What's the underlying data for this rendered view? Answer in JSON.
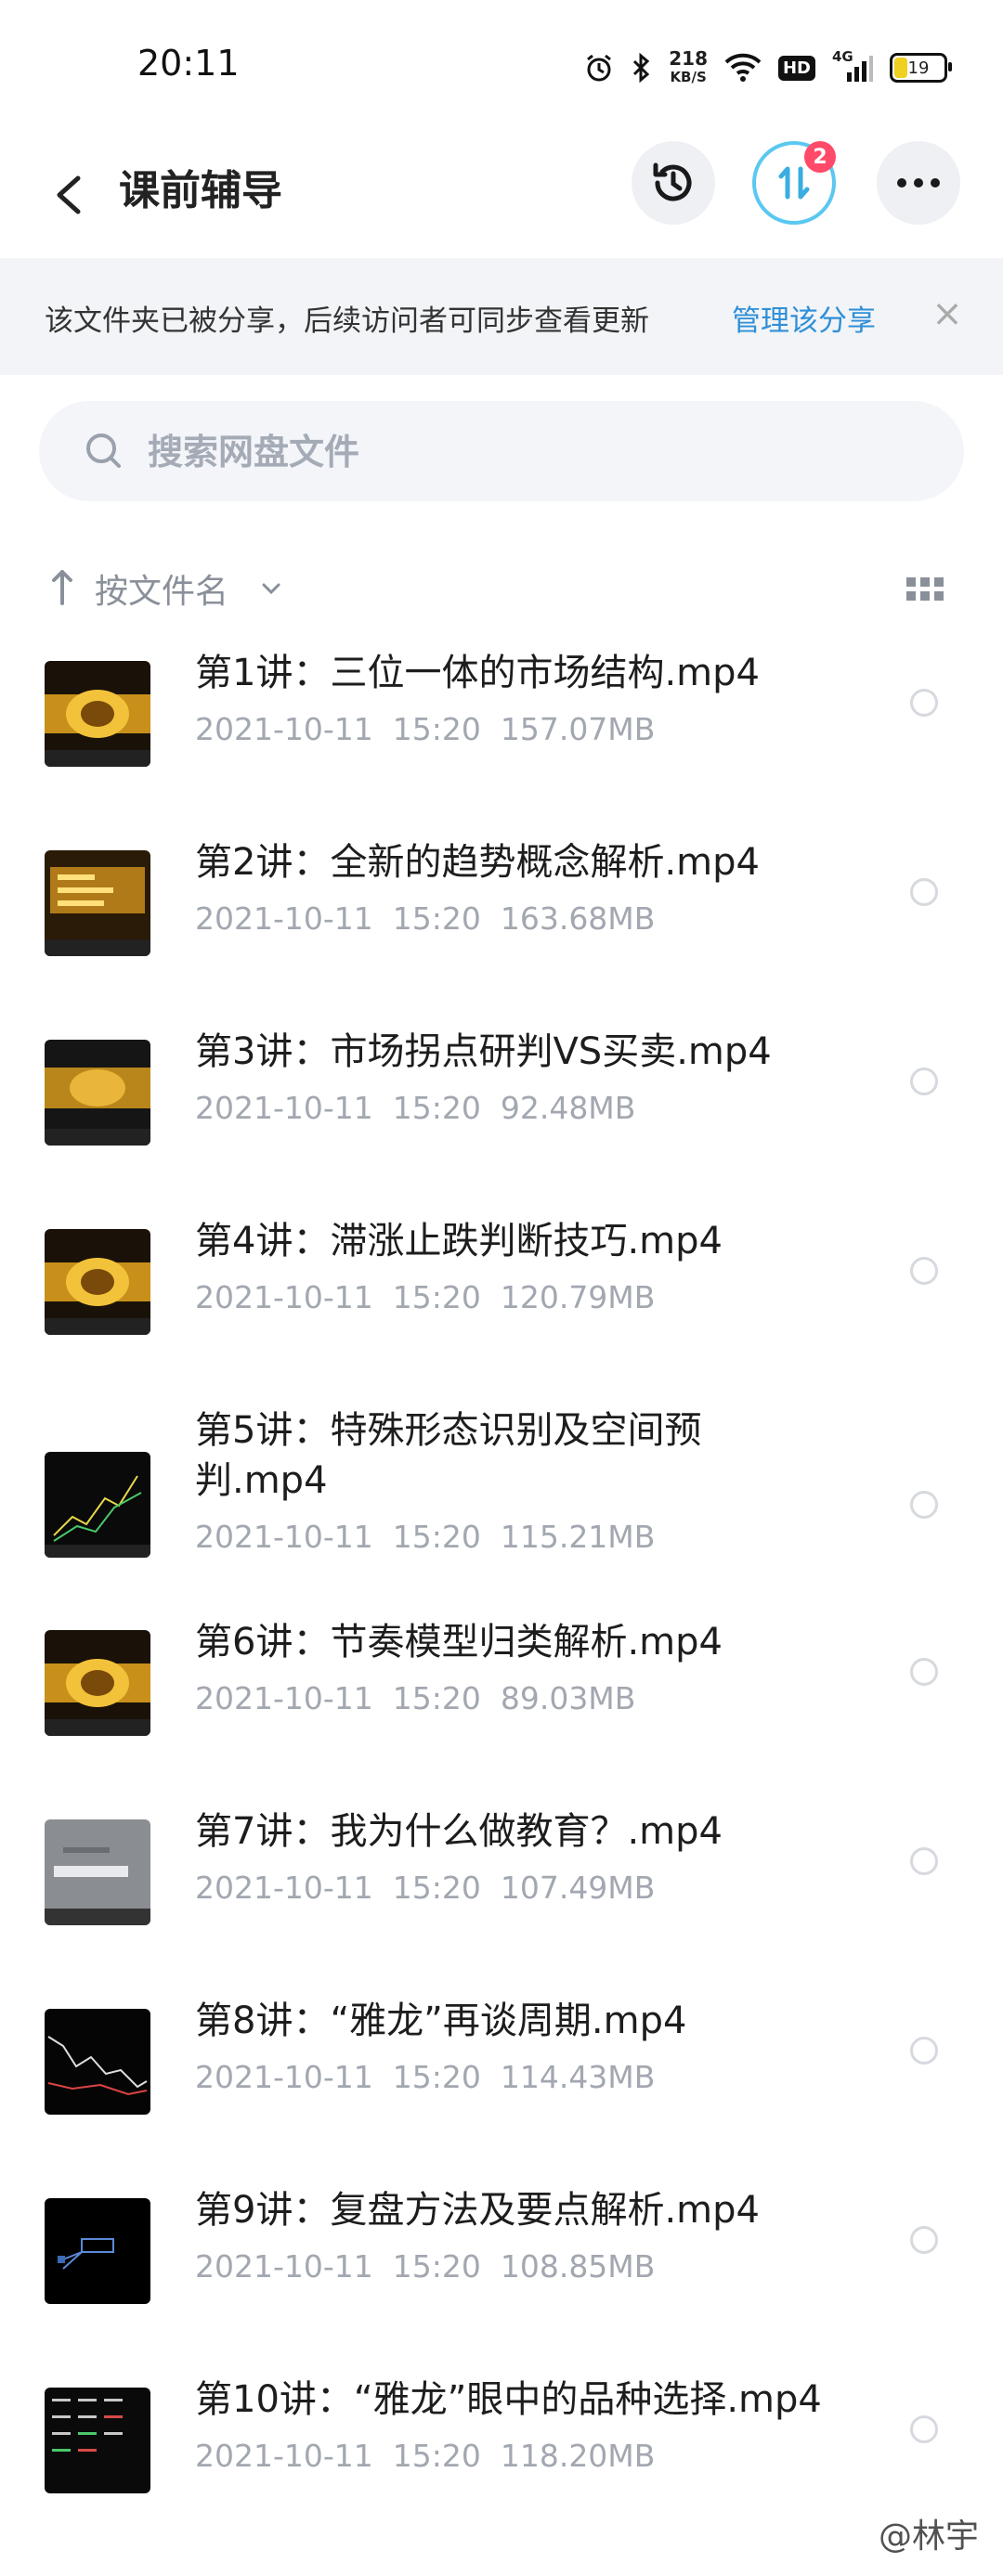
{
  "status_bar": {
    "time": "20:11",
    "network_speed": "218",
    "network_unit": "KB/S",
    "hd_label": "HD",
    "signal_label": "4G",
    "battery": "19"
  },
  "nav": {
    "title": "课前辅导",
    "transfer_badge": "2"
  },
  "share_notice": {
    "text": "该文件夹已被分享，后续访问者可同步查看更新",
    "link": "管理该分享",
    "close": "×"
  },
  "search": {
    "placeholder": "搜索网盘文件"
  },
  "sort": {
    "label": "按文件名"
  },
  "files": [
    {
      "name": "第1讲：三位一体的市场结构.mp4",
      "meta": "2021-10-11  15:20  157.07MB",
      "thumb": "gold"
    },
    {
      "name": "第2讲：全新的趋势概念解析.mp4",
      "meta": "2021-10-11  15:20  163.68MB",
      "thumb": "gold-text"
    },
    {
      "name": "第3讲：市场拐点研判VS买卖.mp4",
      "meta": "2021-10-11  15:20  92.48MB",
      "thumb": "gold-dark"
    },
    {
      "name": "第4讲：滞涨止跌判断技巧.mp4",
      "meta": "2021-10-11  15:20  120.79MB",
      "thumb": "gold"
    },
    {
      "name": "第5讲：特殊形态识别及空间预判.mp4",
      "meta": "2021-10-11  15:20  115.21MB",
      "thumb": "chart"
    },
    {
      "name": "第6讲：节奏模型归类解析.mp4",
      "meta": "2021-10-11  15:20  89.03MB",
      "thumb": "gold"
    },
    {
      "name": "第7讲：我为什么做教育？.mp4",
      "meta": "2021-10-11  15:20  107.49MB",
      "thumb": "gray"
    },
    {
      "name": "第8讲：“雅龙”再谈周期.mp4",
      "meta": "2021-10-11  15:20  114.43MB",
      "thumb": "chart-dark"
    },
    {
      "name": "第9讲：复盘方法及要点解析.mp4",
      "meta": "2021-10-11  15:20  108.85MB",
      "thumb": "black"
    },
    {
      "name": "第10讲：“雅龙”眼中的品种选择.mp4",
      "meta": "2021-10-11  15:20  118.20MB",
      "thumb": "table"
    }
  ],
  "watermark": "@林宇"
}
